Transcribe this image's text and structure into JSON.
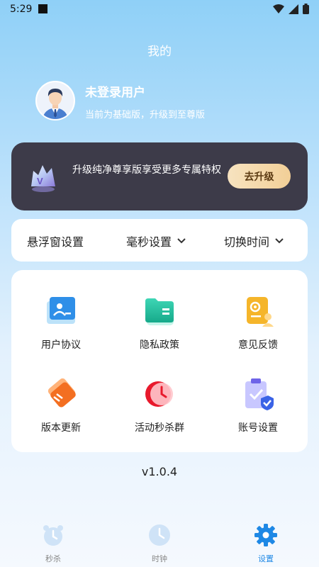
{
  "status_bar": {
    "time": "5:29"
  },
  "header": {
    "title": "我的"
  },
  "user": {
    "name": "未登录用户",
    "subtitle": "当前为基础版，升级到至尊版"
  },
  "vip_banner": {
    "text": "升级纯净尊享版享受更多专属特权",
    "button_label": "去升级"
  },
  "settings_bar": {
    "float_window": "悬浮窗设置",
    "millisecond": "毫秒设置",
    "switch_time": "切换时间"
  },
  "menu": {
    "items": [
      {
        "label": "用户协议",
        "icon": "user-agreement-icon"
      },
      {
        "label": "隐私政策",
        "icon": "privacy-policy-icon"
      },
      {
        "label": "意见反馈",
        "icon": "feedback-icon"
      },
      {
        "label": "版本更新",
        "icon": "version-update-icon"
      },
      {
        "label": "活动秒杀群",
        "icon": "flash-sale-group-icon"
      },
      {
        "label": "账号设置",
        "icon": "account-settings-icon"
      }
    ]
  },
  "version": "v1.0.4",
  "bottom_nav": {
    "tabs": [
      {
        "label": "秒杀",
        "icon": "alarm-clock-icon",
        "active": false
      },
      {
        "label": "时钟",
        "icon": "clock-icon",
        "active": false
      },
      {
        "label": "设置",
        "icon": "gear-icon",
        "active": true
      }
    ]
  },
  "colors": {
    "accent": "#1e88e5",
    "vip_card": "#3d3b49",
    "vip_button": "#f2cf97"
  }
}
